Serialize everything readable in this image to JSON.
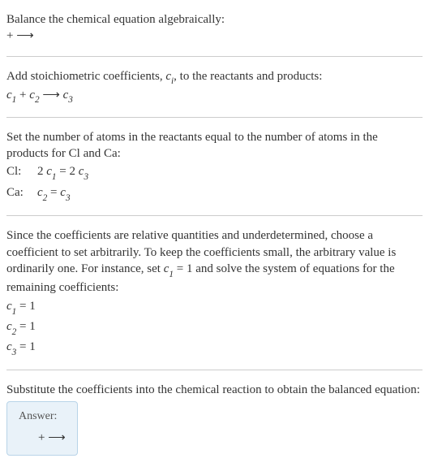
{
  "s1": {
    "line1": "Balance the chemical equation algebraically:",
    "eq": " +  ⟶ "
  },
  "s2": {
    "line1": "Add stoichiometric coefficients, ",
    "ci": "c",
    "ci_sub": "i",
    "line1b": ", to the reactants and products:",
    "c1": "c",
    "c1s": "1",
    "plus": " + ",
    "c2": "c",
    "c2s": "2",
    "arrow": "  ⟶ ",
    "c3": "c",
    "c3s": "3"
  },
  "s3": {
    "line1": "Set the number of atoms in the reactants equal to the number of atoms in the products for Cl and Ca:",
    "cl_label": "Cl:",
    "cl_eq_a": "2 ",
    "cl_c1": "c",
    "cl_c1s": "1",
    "cl_eq_b": " = 2 ",
    "cl_c3": "c",
    "cl_c3s": "3",
    "ca_label": "Ca:",
    "ca_c2": "c",
    "ca_c2s": "2",
    "ca_eq": " = ",
    "ca_c3": "c",
    "ca_c3s": "3"
  },
  "s4": {
    "line1a": "Since the coefficients are relative quantities and underdetermined, choose a coefficient to set arbitrarily. To keep the coefficients small, the arbitrary value is ordinarily one. For instance, set ",
    "set_c": "c",
    "set_cs": "1",
    "set_eq": " = 1",
    "line1b": " and solve the system of equations for the remaining coefficients:",
    "r1a": "c",
    "r1s": "1",
    "r1b": " = 1",
    "r2a": "c",
    "r2s": "2",
    "r2b": " = 1",
    "r3a": "c",
    "r3s": "3",
    "r3b": " = 1"
  },
  "s5": {
    "line1": "Substitute the coefficients into the chemical reaction to obtain the balanced equation:",
    "answer_label": "Answer:",
    "answer_eq": " +  ⟶ "
  }
}
